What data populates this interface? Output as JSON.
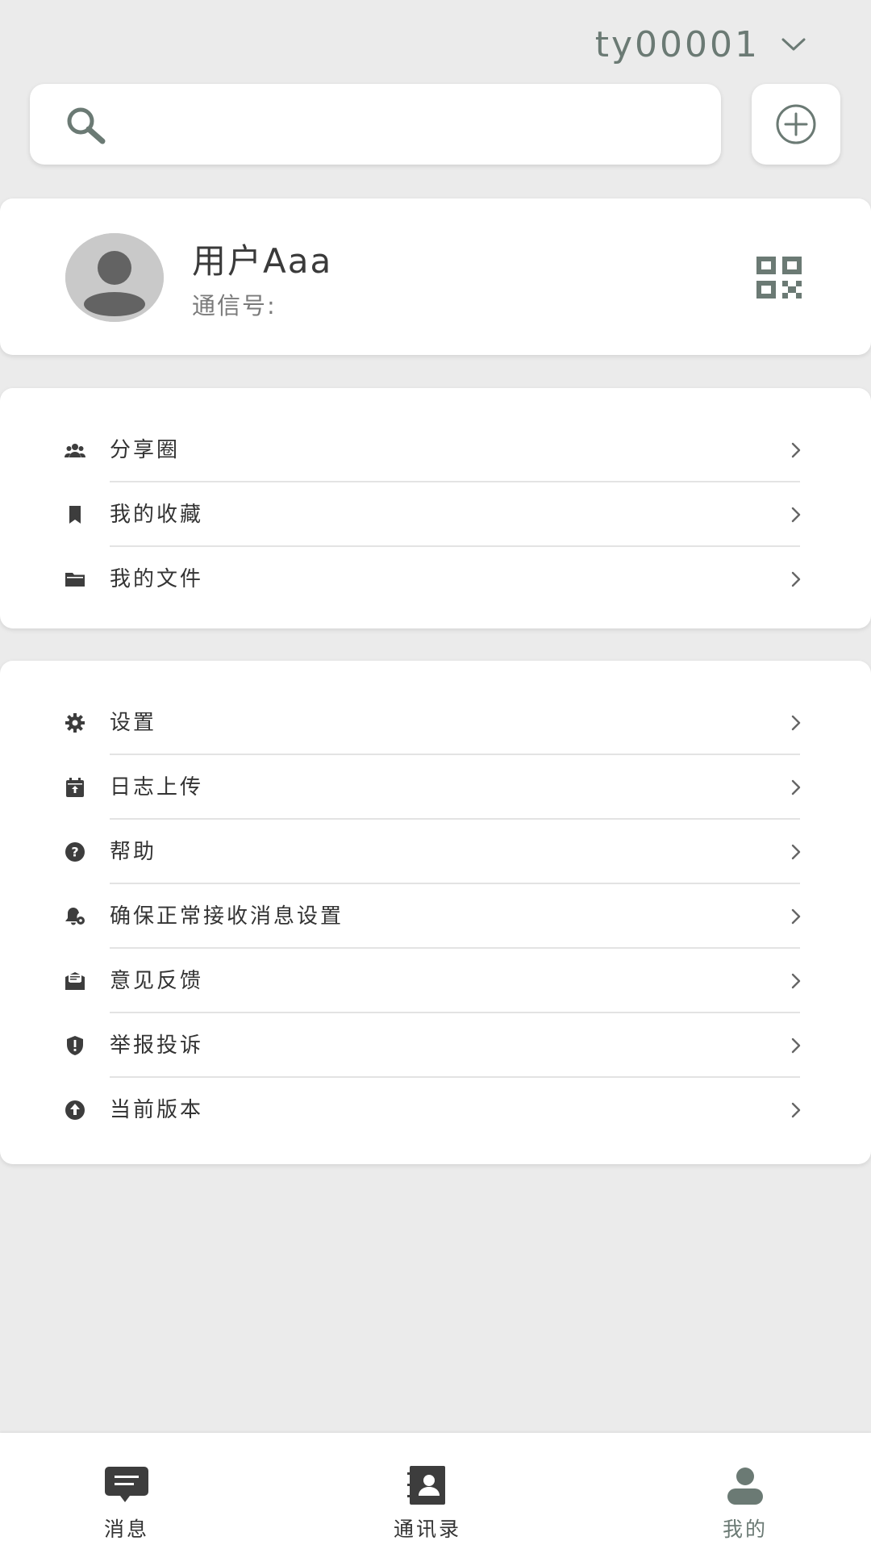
{
  "header": {
    "account_name": "ty00001"
  },
  "search": {
    "placeholder": ""
  },
  "profile": {
    "username": "用户Aaa",
    "account_id_label": "通信号:"
  },
  "menu_group_1": [
    {
      "label": "分享圈",
      "icon": "share-circle-icon"
    },
    {
      "label": "我的收藏",
      "icon": "bookmark-icon"
    },
    {
      "label": "我的文件",
      "icon": "folder-icon"
    }
  ],
  "menu_group_2": [
    {
      "label": "设置",
      "icon": "gear-icon"
    },
    {
      "label": "日志上传",
      "icon": "calendar-upload-icon"
    },
    {
      "label": "帮助",
      "icon": "help-icon"
    },
    {
      "label": "确保正常接收消息设置",
      "icon": "bell-settings-icon"
    },
    {
      "label": "意见反馈",
      "icon": "mail-icon"
    },
    {
      "label": "举报投诉",
      "icon": "shield-alert-icon"
    },
    {
      "label": "当前版本",
      "icon": "upgrade-icon"
    }
  ],
  "bottom_nav": [
    {
      "label": "消息",
      "icon": "chat-icon",
      "active": false
    },
    {
      "label": "通讯录",
      "icon": "contacts-icon",
      "active": false
    },
    {
      "label": "我的",
      "icon": "person-icon",
      "active": true
    }
  ],
  "colors": {
    "accent": "#6b7a74",
    "background": "#ebebeb",
    "card": "#ffffff",
    "icon_dark": "#3d3d3d"
  }
}
